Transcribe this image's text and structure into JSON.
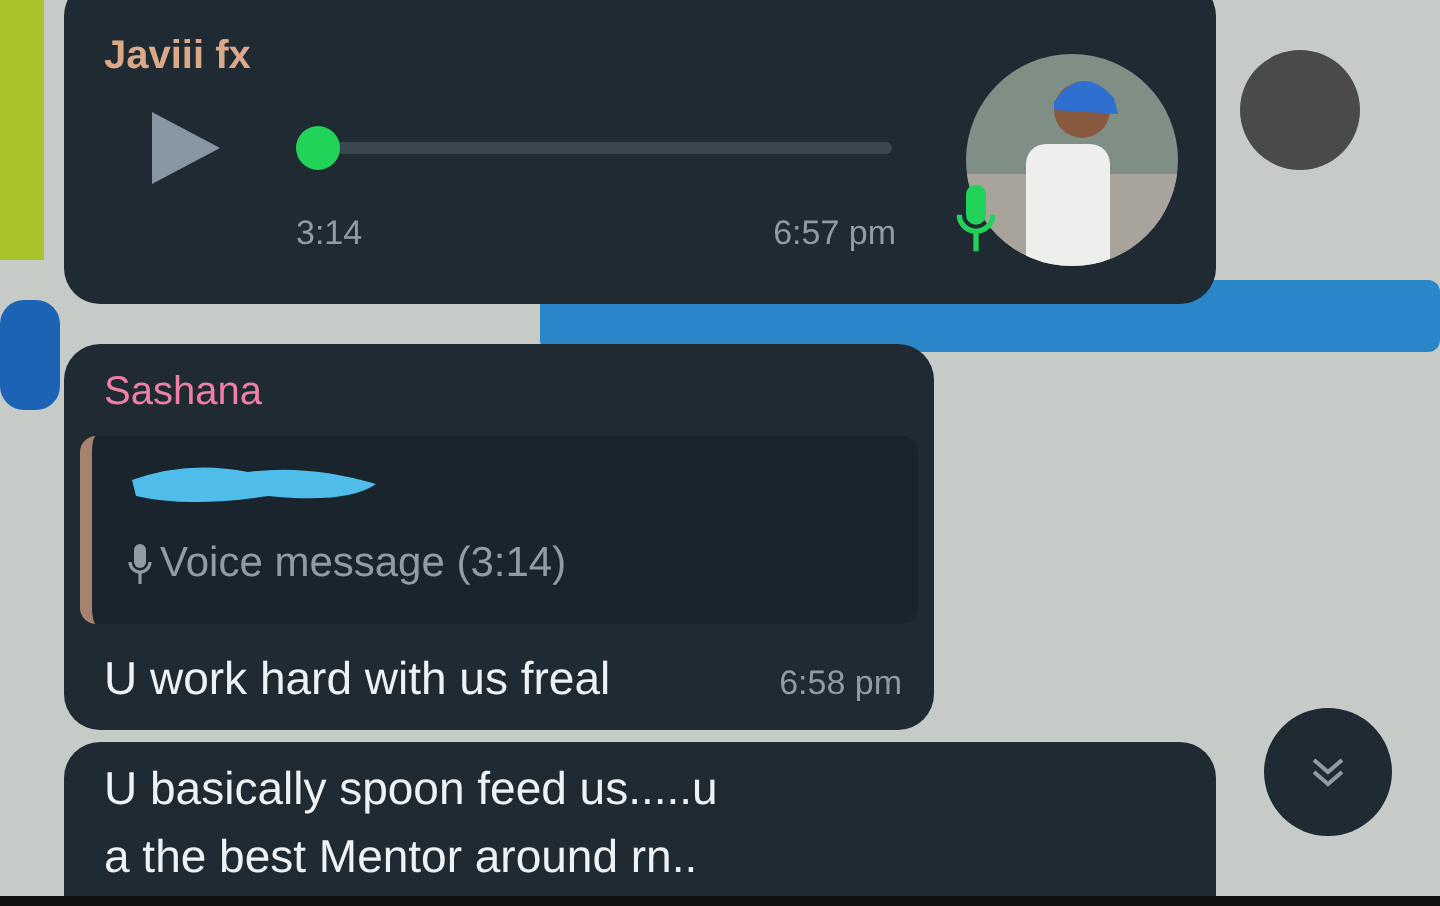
{
  "messages": [
    {
      "kind": "voice",
      "sender": "Javiii fx",
      "color": "#d9a98a",
      "level": 0,
      "duration": "3:14",
      "time": "6:57 pm"
    },
    {
      "kind": "reply",
      "sender": "Sashana",
      "color": "#f07fa8",
      "quote": {
        "text": "Voice message (3:14)"
      },
      "text": "U work hard with us freal",
      "time": "6:58 pm"
    },
    {
      "kind": "text",
      "text": "U basically spoon feed us.....u\na the best Mentor around rn.."
    }
  ]
}
